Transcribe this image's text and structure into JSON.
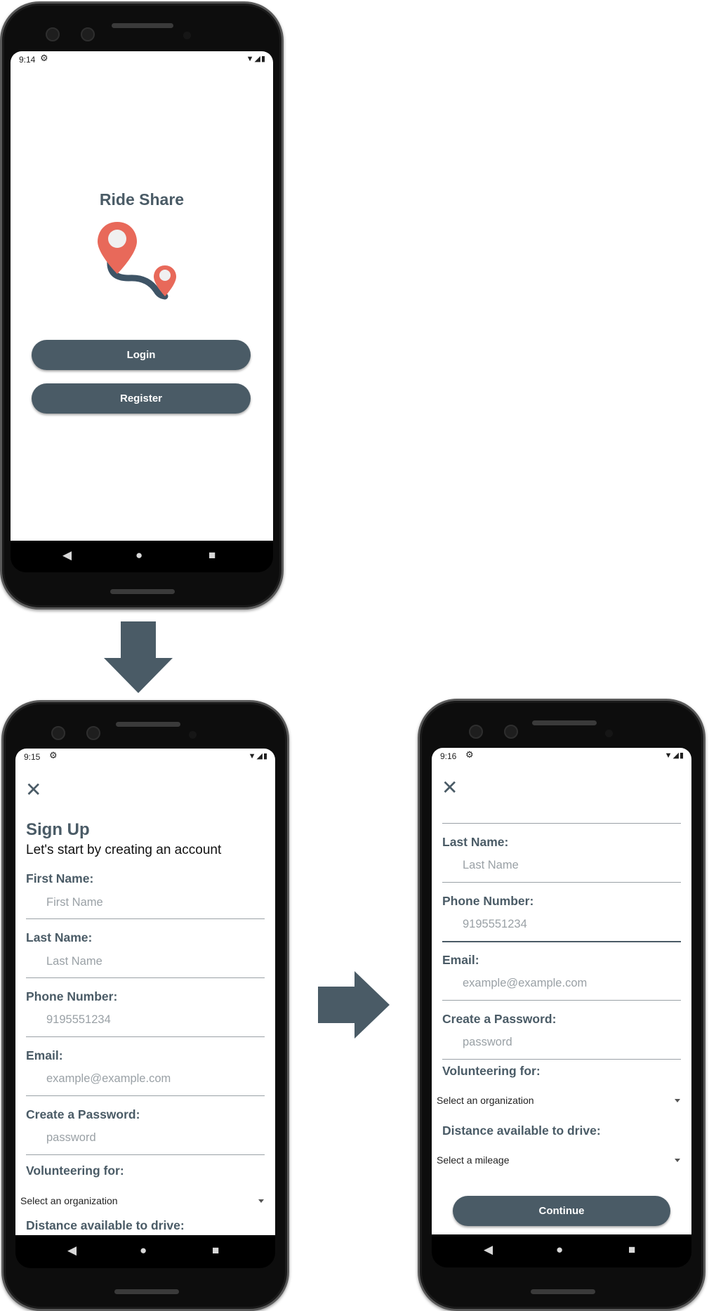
{
  "colors": {
    "primary": "#4a5b66",
    "pin": "#e8695a",
    "pin_core": "#f0f0f0",
    "placeholder": "#9aa1a6"
  },
  "icons": {
    "settings": "gear-icon",
    "wifi": "wifi-icon",
    "battery": "battery-icon",
    "close": "close-icon",
    "dropdown": "caret-down-icon",
    "back": "back-icon",
    "home": "home-icon",
    "recents": "recents-icon"
  },
  "screen1": {
    "time": "9:14",
    "app_title": "Ride Share",
    "login_label": "Login",
    "register_label": "Register"
  },
  "screen2": {
    "time": "9:15",
    "title": "Sign Up",
    "subtitle": "Let's start by creating an account",
    "first_name_label": "First Name:",
    "first_name_placeholder": "First Name",
    "last_name_label": "Last Name:",
    "last_name_placeholder": "Last Name",
    "phone_label": "Phone Number:",
    "phone_placeholder": "9195551234",
    "email_label": "Email:",
    "email_placeholder": "example@example.com",
    "password_label": "Create a Password:",
    "password_placeholder": "password",
    "volunteer_label": "Volunteering for:",
    "organization_select": "Select an organization",
    "distance_label": "Distance available to drive:"
  },
  "screen3": {
    "time": "9:16",
    "last_name_label": "Last Name:",
    "last_name_placeholder": "Last Name",
    "phone_label": "Phone Number:",
    "phone_placeholder": "9195551234",
    "email_label": "Email:",
    "email_placeholder": "example@example.com",
    "password_label": "Create a Password:",
    "password_placeholder": "password",
    "volunteer_label": "Volunteering for:",
    "organization_select": "Select an organization",
    "distance_label": "Distance available to drive:",
    "mileage_select": "Select a mileage",
    "continue_label": "Continue"
  },
  "glyphs": {
    "gear": "⚙",
    "signal": "▼◢▮",
    "close": "✕",
    "back": "◀",
    "home": "●",
    "recents": "■"
  }
}
